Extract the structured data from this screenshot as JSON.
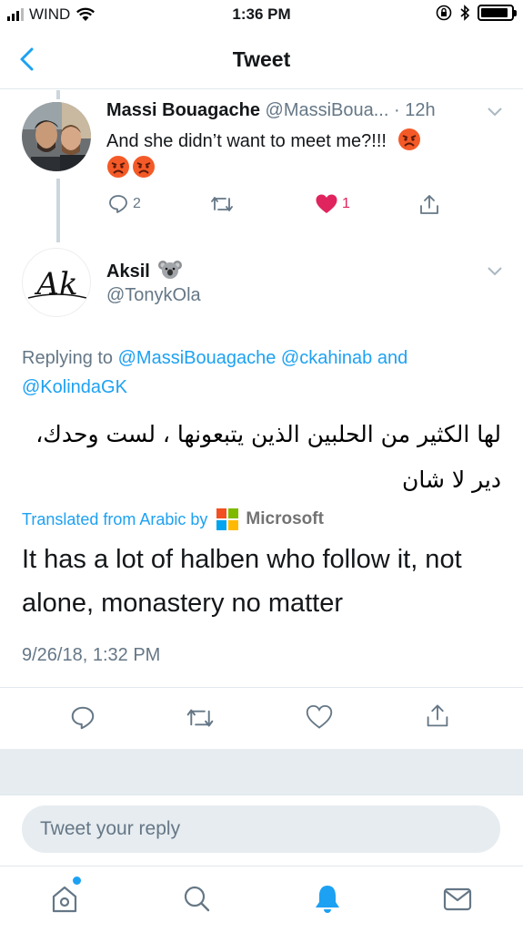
{
  "status_bar": {
    "carrier": "WIND",
    "time": "1:36 PM",
    "battery_level": 0.9
  },
  "nav": {
    "title": "Tweet",
    "back_icon": "chevron-left-icon"
  },
  "parent_tweet": {
    "name": "Massi Bouagache",
    "handle": "@MassiBoua...",
    "separator": " · ",
    "age": "12h",
    "text": "And she didn’t want to meet me?!!!",
    "emoji": "angry-face-icon",
    "actions": {
      "reply_count": "2",
      "retweet_count": "",
      "like_count": "1",
      "liked": true
    }
  },
  "main_tweet": {
    "name": "Aksil",
    "name_emoji": "koala-icon",
    "handle": "@TonykOla",
    "avatar_text": "Ak",
    "replying_prefix": "Replying to ",
    "replying_user_1": "@MassiBouagache",
    "replying_space": " ",
    "replying_user_2": "@ckahinab",
    "replying_and": " and",
    "replying_user_3": "@KolindaGK",
    "original_text": "لها الكثير من الحلبين الذين يتبعونها ، لست وحدك، دير لا شان",
    "translated_label": "Translated from Arabic by",
    "translator": "Microsoft",
    "translated_text": "It has a lot of halben who follow it, not alone, monastery no matter",
    "timestamp": "9/26/18, 1:32 PM"
  },
  "composer": {
    "placeholder": "Tweet your reply"
  },
  "tab_bar": {
    "items": [
      "home-icon",
      "search-icon",
      "notifications-icon",
      "messages-icon"
    ],
    "active": "notifications-icon"
  },
  "colors": {
    "accent": "#1da1f2",
    "like": "#e0245e",
    "secondary_text": "#657786"
  }
}
